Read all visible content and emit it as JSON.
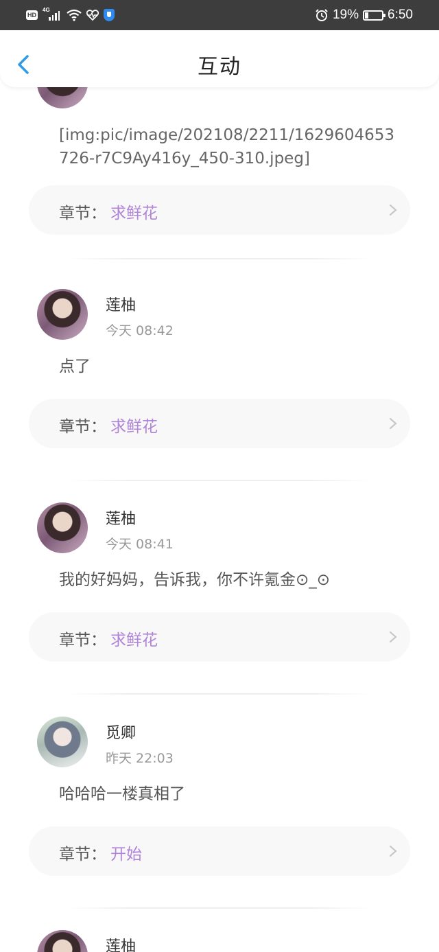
{
  "status_bar": {
    "hd_badge": "HD",
    "network": "4G",
    "battery": "19%",
    "battery_level": 0.19,
    "time": "6:50"
  },
  "header": {
    "title": "互动",
    "back_icon": "chevron-left-icon"
  },
  "chapter_label": "章节：",
  "comments": [
    {
      "author": "",
      "time": "",
      "text": "[img:pic/image/202108/2211/1629604653726-r7C9Ay416y_450-310.jpeg]",
      "chapter": "求鲜花"
    },
    {
      "author": "莲柚",
      "time": "今天 08:42",
      "text": "点了",
      "chapter": "求鲜花"
    },
    {
      "author": "莲柚",
      "time": "今天 08:41",
      "text": "我的好妈妈，告诉我，你不许氪金⊙_⊙",
      "chapter": "求鲜花"
    },
    {
      "author": "觅卿",
      "time": "昨天 22:03",
      "text": "哈哈哈一楼真相了",
      "chapter": "开始"
    },
    {
      "author": "莲柚",
      "time": "",
      "text": "",
      "chapter": ""
    }
  ],
  "colors": {
    "status_bar_bg": "#3d3d3d",
    "accent_back": "#2e9be6",
    "chapter_name": "#b084d8",
    "chapter_bg": "#f8f8f8",
    "time_text": "#999999"
  }
}
